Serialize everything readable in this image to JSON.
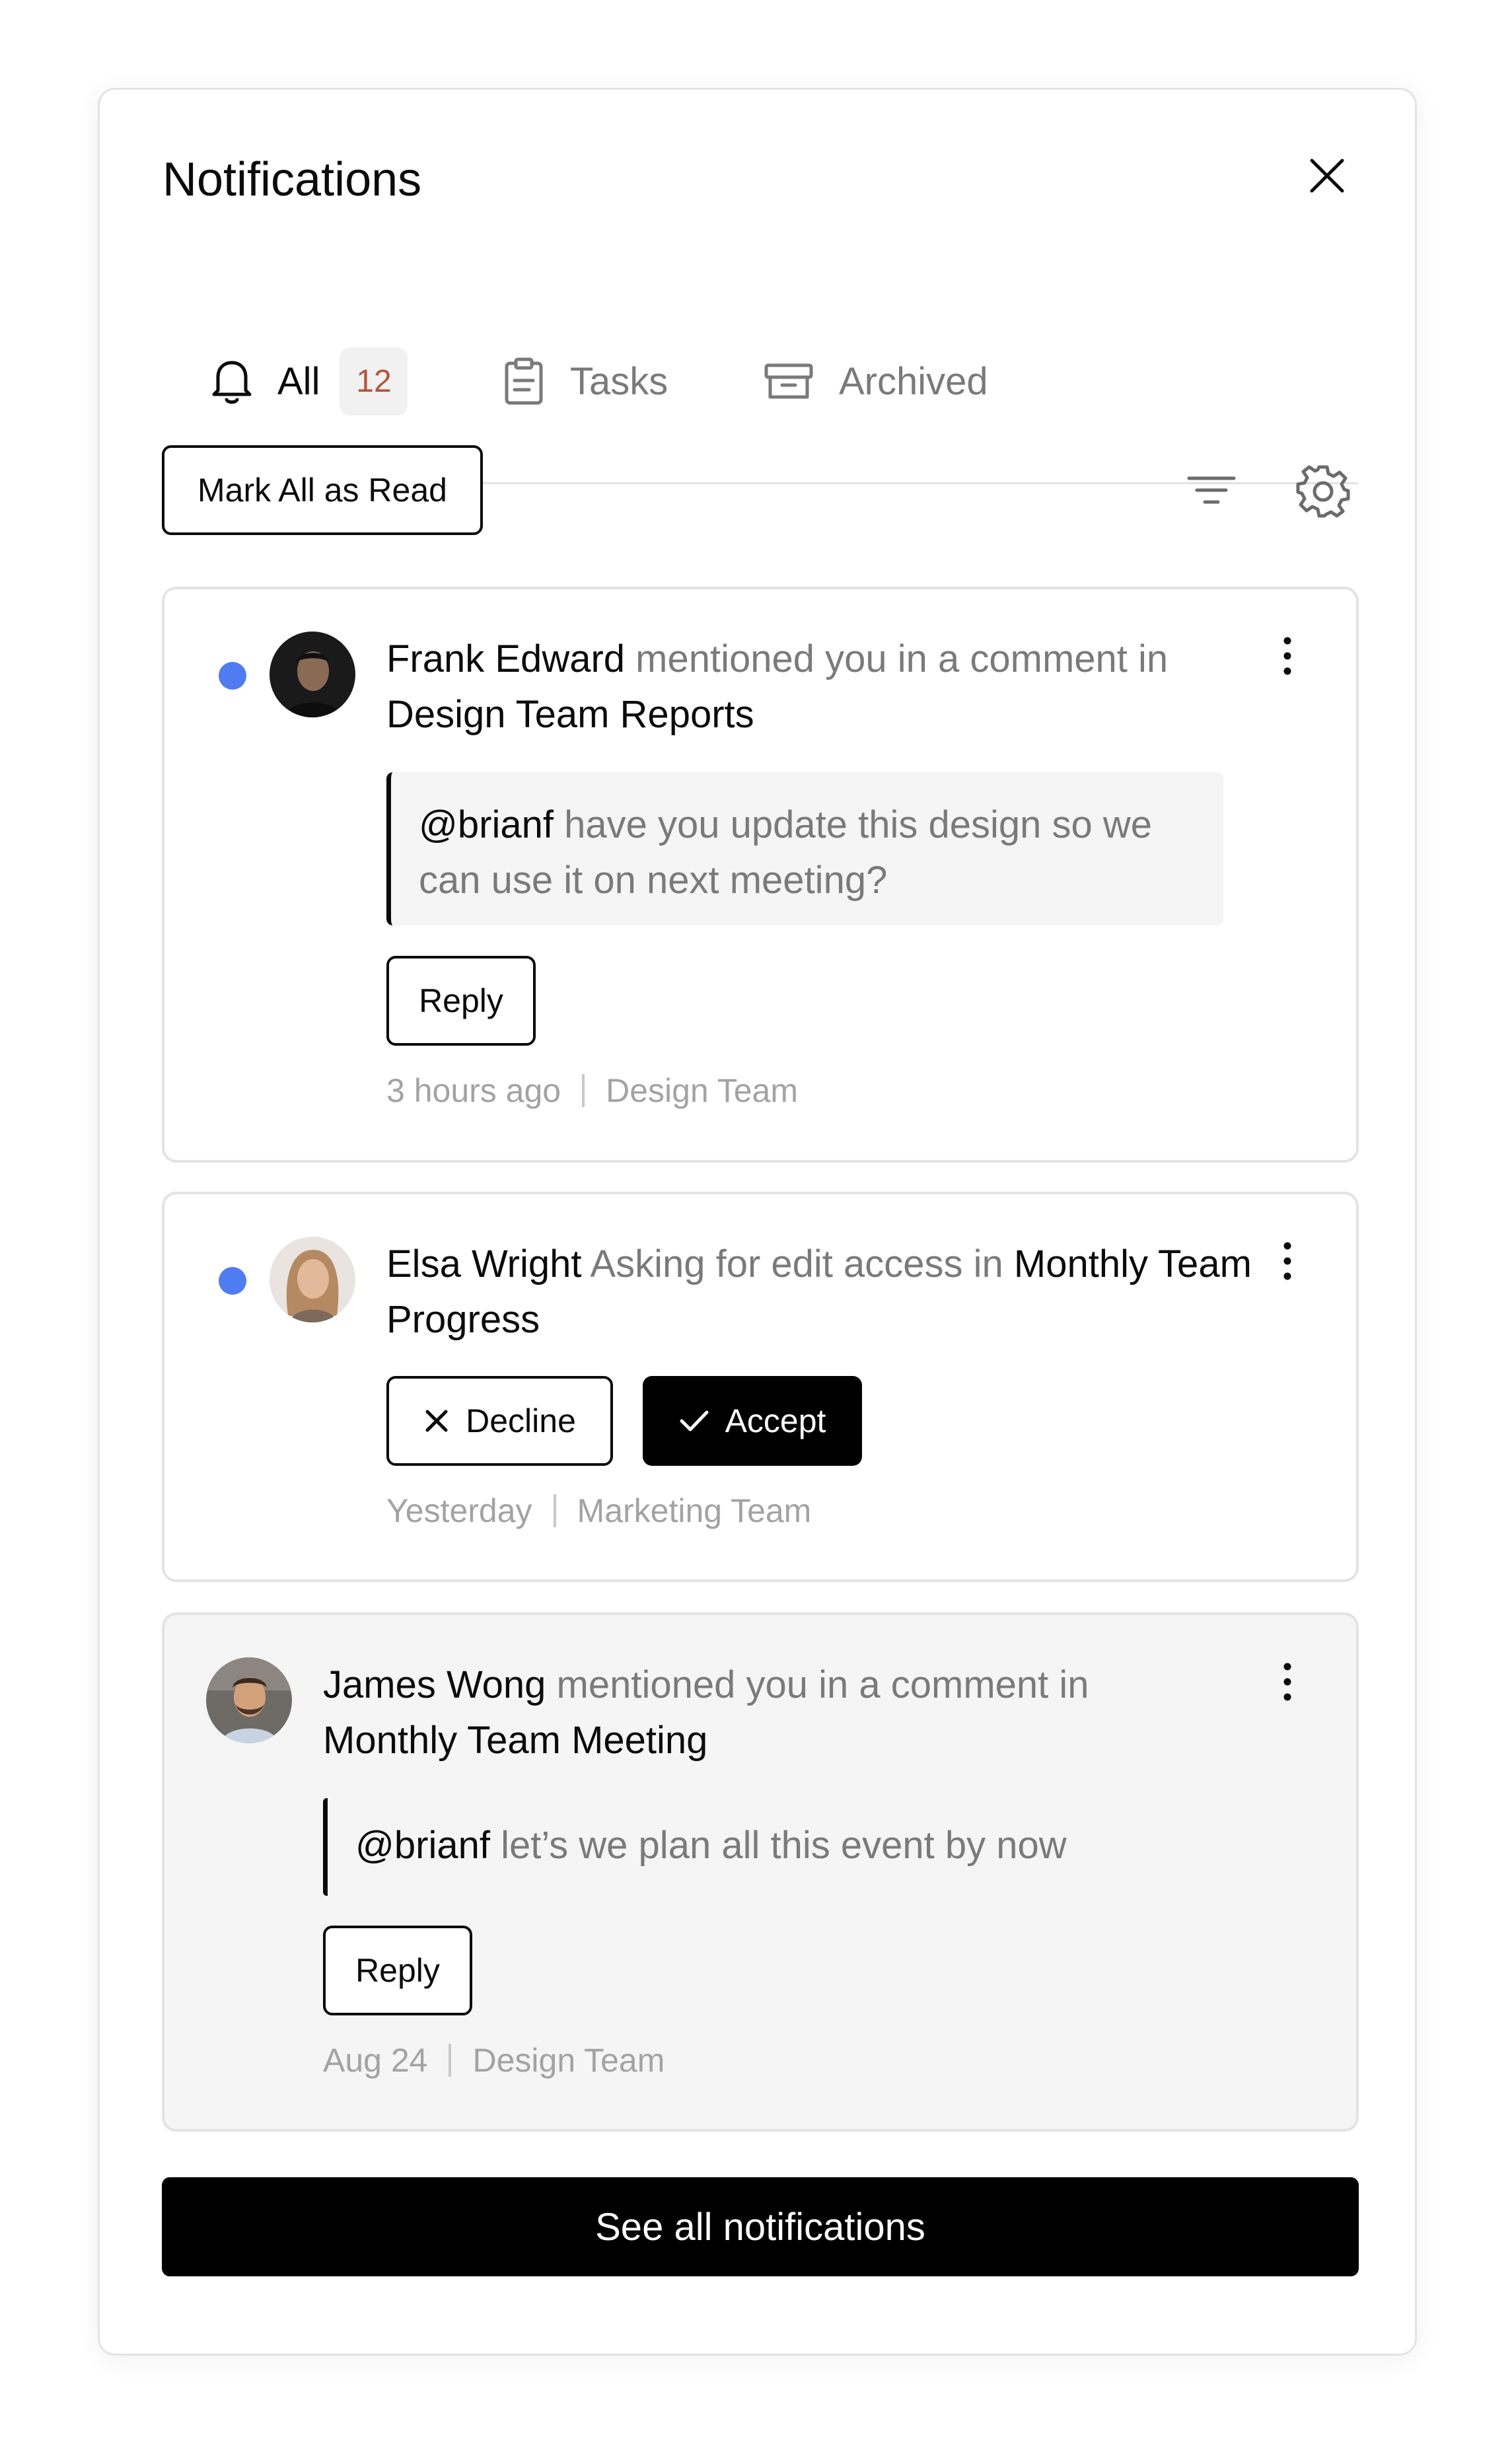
{
  "header": {
    "title": "Notifications",
    "close_icon": "close-icon"
  },
  "tabs": [
    {
      "label": "All",
      "icon": "bell-icon",
      "count": "12",
      "active": true
    },
    {
      "label": "Tasks",
      "icon": "clipboard-icon",
      "active": false
    },
    {
      "label": "Archived",
      "icon": "archive-box-icon",
      "active": false
    }
  ],
  "toolbar": {
    "mark_all_read_label": "Mark All as Read",
    "filter_icon": "filter-icon",
    "settings_icon": "gear-icon"
  },
  "notifications": [
    {
      "unread": true,
      "actor": "Frank Edward",
      "action": " mentioned you in a comment in ",
      "target": "Design Team Reports",
      "comment_mention": "@brianf",
      "comment_text": " have you update this design so we can use it on next meeting?",
      "reply_label": "Reply",
      "time": "3 hours ago",
      "team": "Design Team"
    },
    {
      "unread": true,
      "actor": "Elsa Wright",
      "action": " Asking for edit access in ",
      "target": "Monthly Team Progress",
      "decline_label": "Decline",
      "accept_label": "Accept",
      "time": "Yesterday",
      "team": "Marketing Team"
    },
    {
      "unread": false,
      "actor": "James Wong",
      "action": " mentioned you in a comment in ",
      "target": "Monthly Team Meeting",
      "comment_mention": "@brianf",
      "comment_text": " let’s we plan all this event by now",
      "reply_label": "Reply",
      "time": "Aug 24",
      "team": "Design Team"
    }
  ],
  "footer": {
    "see_all_label": "See all notifications"
  },
  "colors": {
    "unread_dot": "#4f7cf0",
    "badge_text": "#b5533b",
    "primary": "#000000",
    "muted_text": "#7a7a7a"
  }
}
